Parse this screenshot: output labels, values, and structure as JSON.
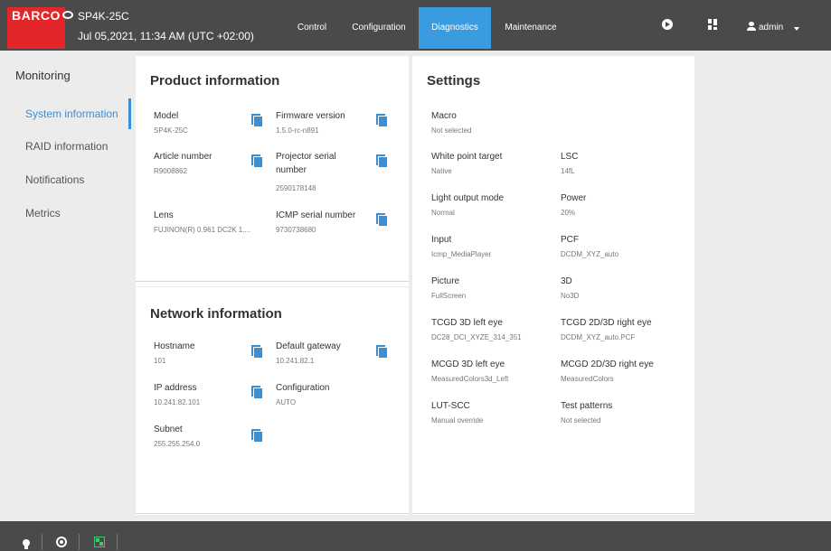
{
  "header": {
    "brand": "BARCO",
    "model": "SP4K-25C",
    "datetime": "Jul 05,2021, 11:34 AM (UTC +02:00)",
    "nav": [
      "Control",
      "Configuration",
      "Diagnostics",
      "Maintenance"
    ],
    "active_nav": "Diagnostics",
    "user": "admin",
    "accent_color": "#3a9ce0",
    "brand_color": "#e2262a"
  },
  "sidebar": {
    "title": "Monitoring",
    "items": [
      "System information",
      "RAID information",
      "Notifications",
      "Metrics"
    ],
    "active": "System information"
  },
  "product": {
    "title": "Product information",
    "fields": [
      {
        "label": "Model",
        "value": "SP4K-25C"
      },
      {
        "label": "Firmware version",
        "value": "1.5.0-rc-n891"
      },
      {
        "label": "Article number",
        "value": "R9008862"
      },
      {
        "label": "Projector serial number",
        "value": "2590178148"
      },
      {
        "label": "Lens",
        "value": "FUJINON(R) 0.961 DC2K 1...."
      },
      {
        "label": "ICMP serial number",
        "value": "9730738680"
      }
    ]
  },
  "network": {
    "title": "Network information",
    "fields": [
      {
        "label": "Hostname",
        "value": "101"
      },
      {
        "label": "Default gateway",
        "value": "10.241.82.1"
      },
      {
        "label": "IP address",
        "value": "10.241.82.101"
      },
      {
        "label": "Configuration",
        "value": "AUTO"
      },
      {
        "label": "Subnet",
        "value": "255.255.254.0"
      }
    ]
  },
  "settings": {
    "title": "Settings",
    "fields": [
      {
        "label": "Macro",
        "value": "Not selected"
      },
      {
        "label": "White point target",
        "value": "Native"
      },
      {
        "label": "LSC",
        "value": "14fL"
      },
      {
        "label": "Light output mode",
        "value": "Normal"
      },
      {
        "label": "Power",
        "value": "20%"
      },
      {
        "label": "Input",
        "value": "Icmp_MediaPlayer"
      },
      {
        "label": "PCF",
        "value": "DCDM_XYZ_auto"
      },
      {
        "label": "Picture",
        "value": "FullScreen"
      },
      {
        "label": "3D",
        "value": "No3D"
      },
      {
        "label": "TCGD 3D left eye",
        "value": "DC28_DCI_XYZE_314_351"
      },
      {
        "label": "TCGD 2D/3D right eye",
        "value": "DCDM_XYZ_auto.PCF"
      },
      {
        "label": "MCGD 3D left eye",
        "value": "MeasuredColors3d_Left"
      },
      {
        "label": "MCGD 2D/3D right eye",
        "value": "MeasuredColors"
      },
      {
        "label": "LUT-SCC",
        "value": "Manual override"
      },
      {
        "label": "Test patterns",
        "value": "Not selected"
      }
    ]
  },
  "footer": {
    "icons": [
      "lightbulb-icon",
      "record-icon",
      "test-pattern-icon"
    ]
  }
}
